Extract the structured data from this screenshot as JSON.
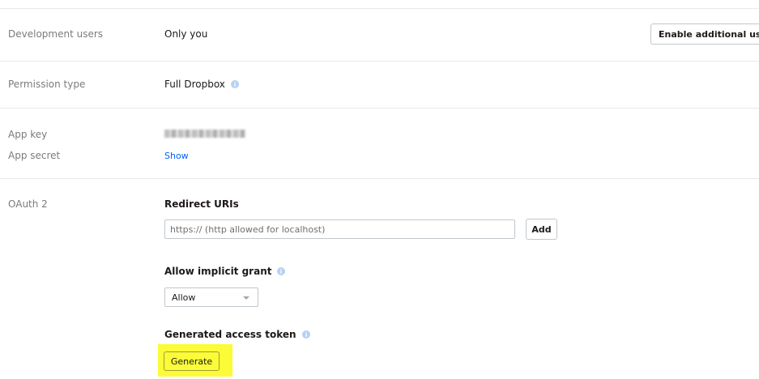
{
  "rows": {
    "dev_users": {
      "label": "Development users",
      "value": "Only you",
      "button": "Enable additional users"
    },
    "permission": {
      "label": "Permission type",
      "value": "Full Dropbox"
    },
    "app_key": {
      "label": "App key"
    },
    "app_secret": {
      "label": "App secret",
      "link": "Show"
    },
    "oauth": {
      "label": "OAuth 2",
      "redirect_heading": "Redirect URIs",
      "redirect_placeholder": "https:// (http allowed for localhost)",
      "add_button": "Add",
      "implicit_heading": "Allow implicit grant",
      "implicit_selected": "Allow",
      "token_heading": "Generated access token",
      "generate_button": "Generate"
    }
  },
  "colors": {
    "link": "#0061fe",
    "highlight": "#fbfb38",
    "info_icon": "#b5d1f3"
  },
  "icons": {
    "info": "info-icon",
    "dropdown": "chevron-down-icon"
  }
}
